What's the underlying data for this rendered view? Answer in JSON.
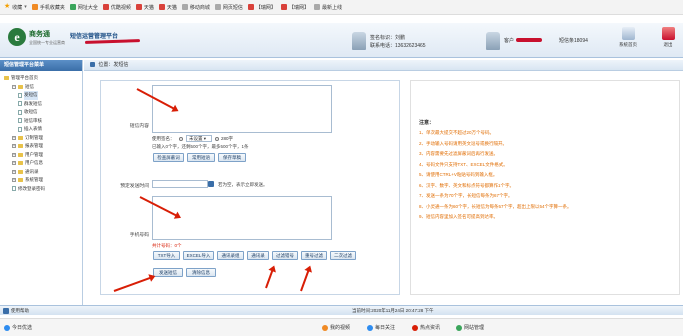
{
  "bookmarks": [
    {
      "label": "收藏",
      "icon": "star-icon"
    },
    {
      "label": "手机收藏夹",
      "icon": "phone-icon"
    },
    {
      "label": "网址大全",
      "icon": "bookmark-icon"
    },
    {
      "label": "优酷视频",
      "icon": "video-icon"
    },
    {
      "label": "天猫",
      "icon": "tmall-icon"
    },
    {
      "label": "天猫",
      "icon": "tmall-icon"
    },
    {
      "label": "移动商城",
      "icon": "doc-icon"
    },
    {
      "label": "网页短信",
      "icon": "doc-icon"
    },
    {
      "label": "【瑞网】",
      "icon": "doc-icon"
    },
    {
      "label": "【瑞网】",
      "icon": "doc-icon"
    },
    {
      "label": "最新上线",
      "icon": "doc-icon"
    }
  ],
  "header": {
    "logo_char": "e",
    "brand": "商务通",
    "brand_title": "短信运营管理平台",
    "brand_sub": "全国统一专业运营商",
    "account1_name": "签名标识：刘鹏",
    "account1_phone": "联系电话：13632623465",
    "account2_user": "客户",
    "account2_balance": "短信条18094",
    "btn_home": "系统首页",
    "btn_exit": "退出"
  },
  "sidebar": {
    "title": "短信管理平台菜单",
    "items": [
      {
        "label": "管理平台首页",
        "level": 0,
        "type": "folder"
      },
      {
        "label": "短信",
        "level": 1,
        "type": "folder",
        "expanded": true
      },
      {
        "label": "发短信",
        "level": 2,
        "type": "leaf",
        "selected": true
      },
      {
        "label": "群发短信",
        "level": 2,
        "type": "leaf"
      },
      {
        "label": "收短信",
        "level": 2,
        "type": "leaf"
      },
      {
        "label": "短信审核",
        "level": 2,
        "type": "leaf"
      },
      {
        "label": "插入表情",
        "level": 2,
        "type": "leaf"
      },
      {
        "label": "订制管理",
        "level": 1,
        "type": "folder"
      },
      {
        "label": "报表管理",
        "level": 1,
        "type": "folder"
      },
      {
        "label": "用户管理",
        "level": 1,
        "type": "folder"
      },
      {
        "label": "用户信息",
        "level": 1,
        "type": "folder"
      },
      {
        "label": "通讯录",
        "level": 1,
        "type": "folder"
      },
      {
        "label": "系统管理",
        "level": 1,
        "type": "folder"
      },
      {
        "label": "修改登录密码",
        "level": 1,
        "type": "leaf"
      }
    ]
  },
  "breadcrumb": "位置：发短信",
  "form": {
    "content_label": "短信内容",
    "sign_label": "使用签名：",
    "sign_select": "未设置",
    "sign_count": "280字",
    "count_hint": "已输入0个字，还剩500个字，最多500个字，1条",
    "btn_check": "检查屏蔽词",
    "btn_common": "常用短语",
    "btn_save": "保存草稿",
    "schedule_label": "预定发送时间",
    "schedule_hint": "若为空，表示立即发送。",
    "phone_label": "手机号码",
    "phone_count": "共计号码：0个",
    "btn_txt": "TXT导入",
    "btn_excel": "EXCEL导入",
    "btn_contacts": "通讯录组",
    "btn_contact2": "通讯录",
    "btn_filter": "过滤错号",
    "btn_dedupe": "重号过滤",
    "btn_secondary": "二次过滤",
    "btn_send": "发送短信",
    "btn_clear": "清除信息"
  },
  "notes": {
    "title": "注意：",
    "items": [
      "1、单次最大提交不超过20万个号码。",
      "2、手动输入号码请用英文逗号或换行隔开。",
      "3、内容需要先过滤屏蔽词后再行发送。",
      "4、号码文件只支持TXT、EXCEL文件格式。",
      "5、请使用CTRL+V粘贴号码到输入框。",
      "6、汉字、数字、英文和标点符号都算作1个字。",
      "7、发送一条为70个字，长短信每条为67个字。",
      "8、小灵通一条为60个字，长短信为每条57个字，超出上限以54个字算一条。",
      "9、短信内容里加入签名可提高到达率。"
    ]
  },
  "statusbar": {
    "left": "使用帮助",
    "center": "当前时间:2020年11月24日 20:47:28 下午"
  },
  "browserbar": [
    {
      "label": "今日优选",
      "icon": "cloud-icon"
    },
    {
      "label": "我的视频",
      "icon": "play-icon"
    },
    {
      "label": "每日关注",
      "icon": "calendar-icon"
    },
    {
      "label": "热点资讯",
      "icon": "fire-icon"
    },
    {
      "label": "网站管理",
      "icon": "globe-icon"
    }
  ],
  "colors": {
    "accent": "#3a6ea8",
    "notice": "#e06c00",
    "arrow": "#d81e06"
  }
}
